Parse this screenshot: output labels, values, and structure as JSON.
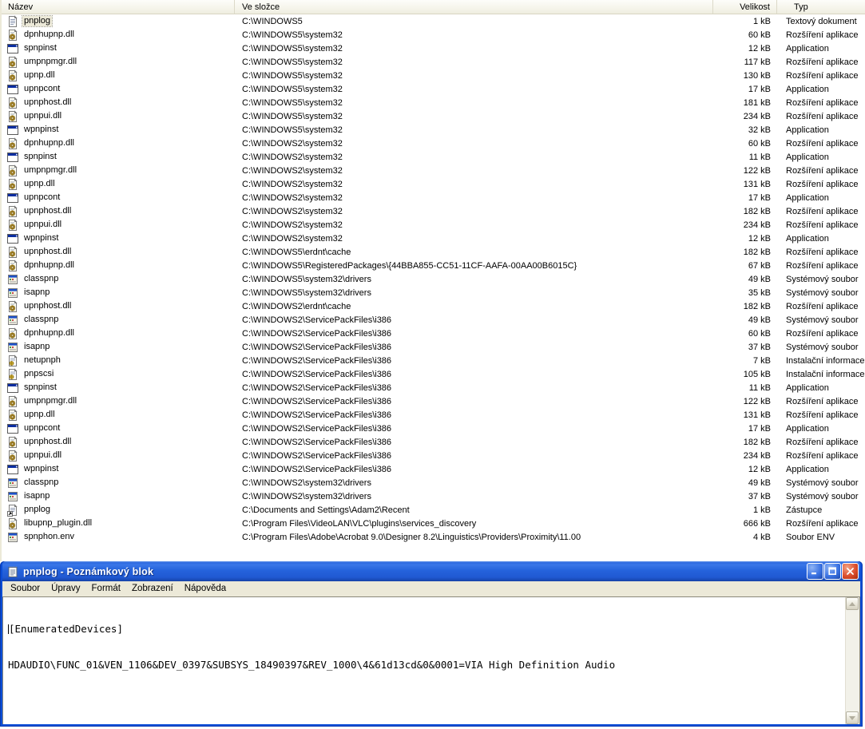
{
  "colors": {
    "titlebar_blue": "#2563dc",
    "close_red": "#dd4f2e",
    "selection_bg": "#ece9d8",
    "menu_bg": "#ece9d8",
    "header_bg": "#f4f3e8"
  },
  "file_list": {
    "columns": [
      {
        "label": "Název"
      },
      {
        "label": "Ve složce"
      },
      {
        "label": "Velikost"
      },
      {
        "label": "Typ"
      }
    ],
    "rows": [
      {
        "name": "pnplog",
        "folder": "C:\\WINDOWS5",
        "size": "1 kB",
        "type": "Textový dokument",
        "icon": "text-document-icon",
        "selected": true
      },
      {
        "name": "dpnhupnp.dll",
        "folder": "C:\\WINDOWS5\\system32",
        "size": "60 kB",
        "type": "Rozšíření aplikace",
        "icon": "dll-icon",
        "selected": false
      },
      {
        "name": "spnpinst",
        "folder": "C:\\WINDOWS5\\system32",
        "size": "12 kB",
        "type": "Application",
        "icon": "application-icon",
        "selected": false
      },
      {
        "name": "umpnpmgr.dll",
        "folder": "C:\\WINDOWS5\\system32",
        "size": "117 kB",
        "type": "Rozšíření aplikace",
        "icon": "dll-icon",
        "selected": false
      },
      {
        "name": "upnp.dll",
        "folder": "C:\\WINDOWS5\\system32",
        "size": "130 kB",
        "type": "Rozšíření aplikace",
        "icon": "dll-icon",
        "selected": false
      },
      {
        "name": "upnpcont",
        "folder": "C:\\WINDOWS5\\system32",
        "size": "17 kB",
        "type": "Application",
        "icon": "application-icon",
        "selected": false
      },
      {
        "name": "upnphost.dll",
        "folder": "C:\\WINDOWS5\\system32",
        "size": "181 kB",
        "type": "Rozšíření aplikace",
        "icon": "dll-icon",
        "selected": false
      },
      {
        "name": "upnpui.dll",
        "folder": "C:\\WINDOWS5\\system32",
        "size": "234 kB",
        "type": "Rozšíření aplikace",
        "icon": "dll-icon",
        "selected": false
      },
      {
        "name": "wpnpinst",
        "folder": "C:\\WINDOWS5\\system32",
        "size": "32 kB",
        "type": "Application",
        "icon": "application-icon",
        "selected": false
      },
      {
        "name": "dpnhupnp.dll",
        "folder": "C:\\WINDOWS2\\system32",
        "size": "60 kB",
        "type": "Rozšíření aplikace",
        "icon": "dll-icon",
        "selected": false
      },
      {
        "name": "spnpinst",
        "folder": "C:\\WINDOWS2\\system32",
        "size": "11 kB",
        "type": "Application",
        "icon": "application-icon",
        "selected": false
      },
      {
        "name": "umpnpmgr.dll",
        "folder": "C:\\WINDOWS2\\system32",
        "size": "122 kB",
        "type": "Rozšíření aplikace",
        "icon": "dll-icon",
        "selected": false
      },
      {
        "name": "upnp.dll",
        "folder": "C:\\WINDOWS2\\system32",
        "size": "131 kB",
        "type": "Rozšíření aplikace",
        "icon": "dll-icon",
        "selected": false
      },
      {
        "name": "upnpcont",
        "folder": "C:\\WINDOWS2\\system32",
        "size": "17 kB",
        "type": "Application",
        "icon": "application-icon",
        "selected": false
      },
      {
        "name": "upnphost.dll",
        "folder": "C:\\WINDOWS2\\system32",
        "size": "182 kB",
        "type": "Rozšíření aplikace",
        "icon": "dll-icon",
        "selected": false
      },
      {
        "name": "upnpui.dll",
        "folder": "C:\\WINDOWS2\\system32",
        "size": "234 kB",
        "type": "Rozšíření aplikace",
        "icon": "dll-icon",
        "selected": false
      },
      {
        "name": "wpnpinst",
        "folder": "C:\\WINDOWS2\\system32",
        "size": "12 kB",
        "type": "Application",
        "icon": "application-icon",
        "selected": false
      },
      {
        "name": "upnphost.dll",
        "folder": "C:\\WINDOWS5\\erdnt\\cache",
        "size": "182 kB",
        "type": "Rozšíření aplikace",
        "icon": "dll-icon",
        "selected": false
      },
      {
        "name": "dpnhupnp.dll",
        "folder": "C:\\WINDOWS5\\RegisteredPackages\\{44BBA855-CC51-11CF-AAFA-00AA00B6015C}",
        "size": "67 kB",
        "type": "Rozšíření aplikace",
        "icon": "dll-icon",
        "selected": false
      },
      {
        "name": "classpnp",
        "folder": "C:\\WINDOWS5\\system32\\drivers",
        "size": "49 kB",
        "type": "Systémový soubor",
        "icon": "system-file-icon",
        "selected": false
      },
      {
        "name": "isapnp",
        "folder": "C:\\WINDOWS5\\system32\\drivers",
        "size": "35 kB",
        "type": "Systémový soubor",
        "icon": "system-file-icon",
        "selected": false
      },
      {
        "name": "upnphost.dll",
        "folder": "C:\\WINDOWS2\\erdnt\\cache",
        "size": "182 kB",
        "type": "Rozšíření aplikace",
        "icon": "dll-icon",
        "selected": false
      },
      {
        "name": "classpnp",
        "folder": "C:\\WINDOWS2\\ServicePackFiles\\i386",
        "size": "49 kB",
        "type": "Systémový soubor",
        "icon": "system-file-icon",
        "selected": false
      },
      {
        "name": "dpnhupnp.dll",
        "folder": "C:\\WINDOWS2\\ServicePackFiles\\i386",
        "size": "60 kB",
        "type": "Rozšíření aplikace",
        "icon": "dll-icon",
        "selected": false
      },
      {
        "name": "isapnp",
        "folder": "C:\\WINDOWS2\\ServicePackFiles\\i386",
        "size": "37 kB",
        "type": "Systémový soubor",
        "icon": "system-file-icon",
        "selected": false
      },
      {
        "name": "netupnph",
        "folder": "C:\\WINDOWS2\\ServicePackFiles\\i386",
        "size": "7 kB",
        "type": "Instalační informace",
        "icon": "setup-information-icon",
        "selected": false
      },
      {
        "name": "pnpscsi",
        "folder": "C:\\WINDOWS2\\ServicePackFiles\\i386",
        "size": "105 kB",
        "type": "Instalační informace",
        "icon": "setup-information-icon",
        "selected": false
      },
      {
        "name": "spnpinst",
        "folder": "C:\\WINDOWS2\\ServicePackFiles\\i386",
        "size": "11 kB",
        "type": "Application",
        "icon": "application-icon",
        "selected": false
      },
      {
        "name": "umpnpmgr.dll",
        "folder": "C:\\WINDOWS2\\ServicePackFiles\\i386",
        "size": "122 kB",
        "type": "Rozšíření aplikace",
        "icon": "dll-icon",
        "selected": false
      },
      {
        "name": "upnp.dll",
        "folder": "C:\\WINDOWS2\\ServicePackFiles\\i386",
        "size": "131 kB",
        "type": "Rozšíření aplikace",
        "icon": "dll-icon",
        "selected": false
      },
      {
        "name": "upnpcont",
        "folder": "C:\\WINDOWS2\\ServicePackFiles\\i386",
        "size": "17 kB",
        "type": "Application",
        "icon": "application-icon",
        "selected": false
      },
      {
        "name": "upnphost.dll",
        "folder": "C:\\WINDOWS2\\ServicePackFiles\\i386",
        "size": "182 kB",
        "type": "Rozšíření aplikace",
        "icon": "dll-icon",
        "selected": false
      },
      {
        "name": "upnpui.dll",
        "folder": "C:\\WINDOWS2\\ServicePackFiles\\i386",
        "size": "234 kB",
        "type": "Rozšíření aplikace",
        "icon": "dll-icon",
        "selected": false
      },
      {
        "name": "wpnpinst",
        "folder": "C:\\WINDOWS2\\ServicePackFiles\\i386",
        "size": "12 kB",
        "type": "Application",
        "icon": "application-icon",
        "selected": false
      },
      {
        "name": "classpnp",
        "folder": "C:\\WINDOWS2\\system32\\drivers",
        "size": "49 kB",
        "type": "Systémový soubor",
        "icon": "system-file-icon",
        "selected": false
      },
      {
        "name": "isapnp",
        "folder": "C:\\WINDOWS2\\system32\\drivers",
        "size": "37 kB",
        "type": "Systémový soubor",
        "icon": "system-file-icon",
        "selected": false
      },
      {
        "name": "pnplog",
        "folder": "C:\\Documents and Settings\\Adam2\\Recent",
        "size": "1 kB",
        "type": "Zástupce",
        "icon": "shortcut-text-document-icon",
        "selected": false
      },
      {
        "name": "libupnp_plugin.dll",
        "folder": "C:\\Program Files\\VideoLAN\\VLC\\plugins\\services_discovery",
        "size": "666 kB",
        "type": "Rozšíření aplikace",
        "icon": "dll-icon",
        "selected": false
      },
      {
        "name": "spnphon.env",
        "folder": "C:\\Program Files\\Adobe\\Acrobat 9.0\\Designer 8.2\\Linguistics\\Providers\\Proximity\\11.00",
        "size": "4 kB",
        "type": "Soubor ENV",
        "icon": "system-file-icon",
        "selected": false
      }
    ]
  },
  "notepad": {
    "title": "pnplog - Poznámkový blok",
    "title_icon": "notepad-icon",
    "menu": [
      "Soubor",
      "Úpravy",
      "Formát",
      "Zobrazení",
      "Nápověda"
    ],
    "window_buttons": [
      "minimize",
      "maximize",
      "close"
    ],
    "content_lines": [
      "[EnumeratedDevices]",
      "HDAUDIO\\FUNC_01&VEN_1106&DEV_0397&SUBSYS_18490397&REV_1000\\4&61d13cd&0&0001=VIA High Definition Audio"
    ]
  }
}
